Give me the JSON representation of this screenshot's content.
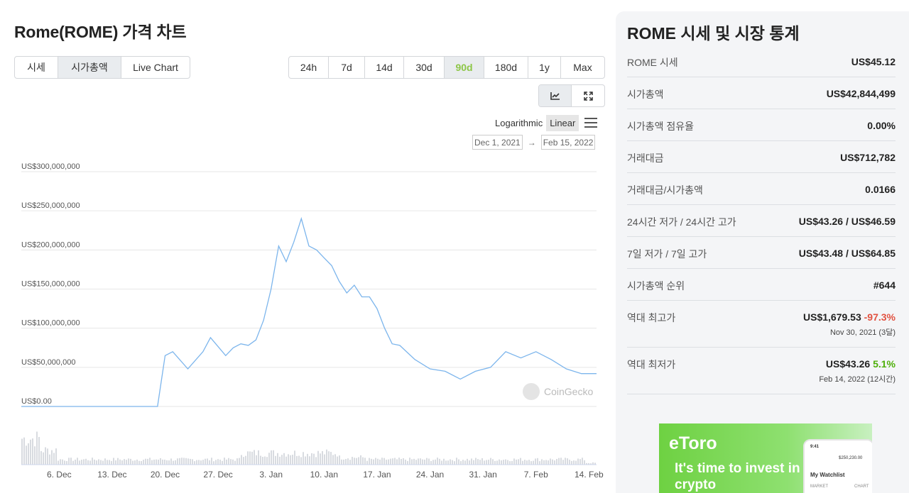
{
  "page": {
    "title": "Rome(ROME) 가격 차트"
  },
  "tabs": [
    {
      "label": "시세",
      "width": 61,
      "active": false
    },
    {
      "label": "시가총액",
      "width": 89,
      "active": true
    },
    {
      "label": "Live Chart",
      "width": 96,
      "active": false
    }
  ],
  "ranges": [
    {
      "label": "24h",
      "width": 56
    },
    {
      "label": "7d",
      "width": 51
    },
    {
      "label": "14d",
      "width": 55
    },
    {
      "label": "30d",
      "width": 57
    },
    {
      "label": "90d",
      "width": 56,
      "active": true
    },
    {
      "label": "180d",
      "width": 62
    },
    {
      "label": "1y",
      "width": 46
    },
    {
      "label": "Max",
      "width": 61
    }
  ],
  "scale": {
    "log_label": "Logarithmic",
    "linear_label": "Linear"
  },
  "dates": {
    "from": "Dec 1, 2021",
    "arrow": "→",
    "to": "Feb 15, 2022"
  },
  "watermark": "CoinGecko",
  "chart_data": {
    "type": "line",
    "title": "",
    "ylabel": "",
    "ylim": [
      0,
      300000000
    ],
    "y_ticks": [
      "US$300,000,000",
      "US$250,000,000",
      "US$200,000,000",
      "US$150,000,000",
      "US$100,000,000",
      "US$50,000,000",
      "US$0.00"
    ],
    "y_tick_values": [
      300000000,
      250000000,
      200000000,
      150000000,
      100000000,
      50000000,
      0
    ],
    "x_ticks": [
      "6. Dec",
      "13. Dec",
      "20. Dec",
      "27. Dec",
      "3. Jan",
      "10. Jan",
      "17. Jan",
      "24. Jan",
      "31. Jan",
      "7. Feb",
      "14. Feb"
    ],
    "xlim": [
      "2021-12-01",
      "2022-02-15"
    ],
    "x": [
      "2021-12-01",
      "2021-12-19",
      "2021-12-20",
      "2021-12-21",
      "2021-12-23",
      "2021-12-25",
      "2021-12-26",
      "2021-12-28",
      "2021-12-29",
      "2021-12-30",
      "2021-12-31",
      "2022-01-01",
      "2022-01-02",
      "2022-01-03",
      "2022-01-04",
      "2022-01-05",
      "2022-01-06",
      "2022-01-07",
      "2022-01-08",
      "2022-01-09",
      "2022-01-10",
      "2022-01-11",
      "2022-01-12",
      "2022-01-13",
      "2022-01-14",
      "2022-01-15",
      "2022-01-16",
      "2022-01-17",
      "2022-01-18",
      "2022-01-19",
      "2022-01-20",
      "2022-01-22",
      "2022-01-24",
      "2022-01-26",
      "2022-01-28",
      "2022-01-30",
      "2022-02-01",
      "2022-02-03",
      "2022-02-05",
      "2022-02-07",
      "2022-02-09",
      "2022-02-11",
      "2022-02-13",
      "2022-02-15"
    ],
    "values": [
      0,
      0,
      65000000,
      70000000,
      48000000,
      70000000,
      88000000,
      65000000,
      75000000,
      80000000,
      78000000,
      85000000,
      110000000,
      150000000,
      205000000,
      185000000,
      210000000,
      240000000,
      205000000,
      200000000,
      190000000,
      180000000,
      160000000,
      145000000,
      155000000,
      140000000,
      140000000,
      125000000,
      100000000,
      80000000,
      78000000,
      60000000,
      48000000,
      45000000,
      35000000,
      45000000,
      50000000,
      70000000,
      62000000,
      70000000,
      60000000,
      48000000,
      42000000,
      42000000
    ],
    "volume_min": 0,
    "volume_max": 100,
    "grid": true,
    "legend": "none"
  },
  "stats": {
    "title": "ROME 시세 및 시장 통계",
    "rows": [
      {
        "label": "ROME 시세",
        "value": "US$45.12"
      },
      {
        "label": "시가총액",
        "value": "US$42,844,499"
      },
      {
        "label": "시가총액 점유율",
        "value": "0.00%"
      },
      {
        "label": "거래대금",
        "value": "US$712,782"
      },
      {
        "label": "거래대금/시가총액",
        "value": "0.0166"
      },
      {
        "label": "24시간 저가 / 24시간 고가",
        "value": "US$43.26 / US$46.59"
      },
      {
        "label": "7일 저가 / 7일 고가",
        "value": "US$43.48 / US$64.85"
      },
      {
        "label": "시가총액 순위",
        "value": "#644"
      },
      {
        "label": "역대 최고가",
        "value": "US$1,679.53",
        "change": "-97.3%",
        "change_color": "red",
        "sub": "Nov 30, 2021 (3달)"
      },
      {
        "label": "역대 최저가",
        "value": "US$43.26",
        "change": "5.1%",
        "change_color": "green",
        "sub": "Feb 14, 2022 (12시간)"
      }
    ]
  },
  "ad": {
    "logo": "eToro",
    "headline": "It's time to invest in crypto",
    "phone_time": "9:41",
    "phone_balance": "$250,230.00",
    "phone_watchlist": "My Watchlist",
    "phone_col1": "MARKET",
    "phone_col2": "CHART"
  }
}
